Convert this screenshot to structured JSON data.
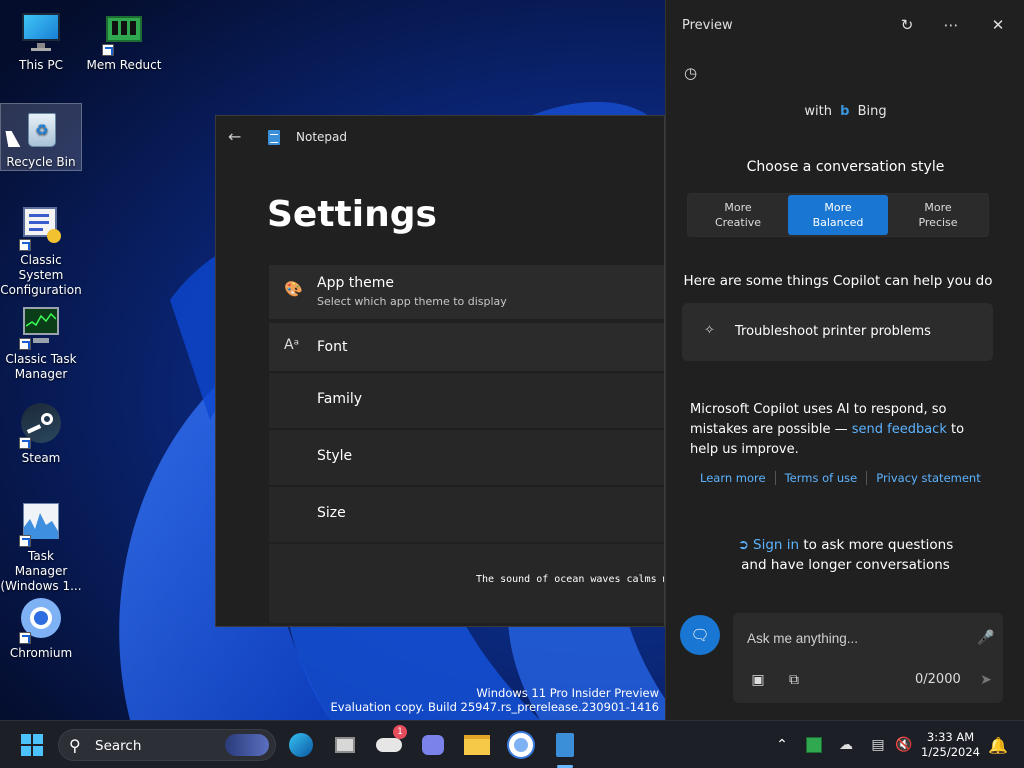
{
  "desktop": {
    "icons": [
      {
        "label": "This PC"
      },
      {
        "label": "Mem Reduct"
      },
      {
        "label": "Recycle Bin"
      },
      {
        "label": "Classic System Configuration"
      },
      {
        "label": "Classic Task Manager"
      },
      {
        "label": "Steam"
      },
      {
        "label": "Task Manager (Windows 1..."
      },
      {
        "label": "Chromium"
      }
    ],
    "watermark": {
      "line1": "Windows 11 Pro Insider Preview",
      "line2": "Evaluation copy. Build 25947.rs_prerelease.230901-1416"
    }
  },
  "notepad": {
    "app_name": "Notepad",
    "page_title": "Settings",
    "app_theme": {
      "title": "App theme",
      "subtitle": "Select which app theme to display"
    },
    "font": {
      "title": "Font",
      "family": "Family",
      "style": "Style",
      "size": "Size"
    },
    "preview_text": "The sound of ocean waves calms m"
  },
  "copilot": {
    "pane_title": "Preview",
    "with_label": "with",
    "bing_label": "Bing",
    "style_heading": "Choose a conversation style",
    "styles": [
      {
        "line1": "More",
        "line2": "Creative"
      },
      {
        "line1": "More",
        "line2": "Balanced"
      },
      {
        "line1": "More",
        "line2": "Precise"
      }
    ],
    "selected_style_index": 1,
    "help_heading": "Here are some things Copilot can help you do",
    "suggestion": "Troubleshoot printer problems",
    "disclaimer_pre": "Microsoft Copilot uses AI to respond, so mistakes are possible — ",
    "disclaimer_link": "send feedback",
    "disclaimer_post": " to help us improve.",
    "links": [
      "Learn more",
      "Terms of use",
      "Privacy statement"
    ],
    "signin_link": "Sign in",
    "signin_rest": " to ask more questions and have longer conversations",
    "composer": {
      "placeholder": "Ask me anything...",
      "char_count": "0/2000"
    },
    "accent_color": "#1976d2"
  },
  "taskbar": {
    "search_label": "Search",
    "weather_badge": "1",
    "time": "3:33 AM",
    "date": "1/25/2024"
  }
}
